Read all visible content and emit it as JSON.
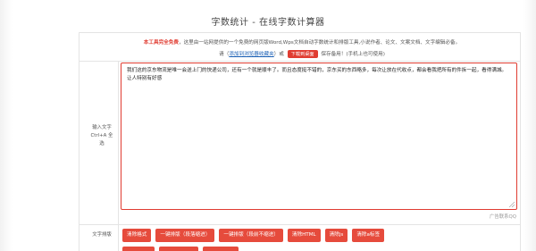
{
  "header": {
    "title": "字数统计 - 在线字数计算器"
  },
  "intro": {
    "free_label": "本工具完全免费",
    "description": "，这里由一站网提供的一个免费的网页版Word,Wps文档自动字数统计和排版工具,小说作者、论文、文案文档、文字编辑必备。",
    "please_prefix": "请（",
    "bookmark_link": "添加到浏览器收藏夹",
    "or_text": "）或",
    "download_button": "下载到桌面",
    "save_suffix": "保存备用！(手机上也可使用)"
  },
  "input_row": {
    "label_line1": "输入文字",
    "label_line2": "Ctrl+A 全",
    "label_line3": "选",
    "text": "我们这的京东物流是唯一会送上门的快递公司，还有一个就是顺丰了。而且态度挺不错的，京东买的东西略多，每次让放在代收点，都会看我把所有的件拆一起，看得满城。让人特别有好感"
  },
  "ad": {
    "label": "广告联系QQ"
  },
  "format_row": {
    "label": "文字排版",
    "buttons": [
      {
        "label": "清除格式"
      },
      {
        "label": "一键排版（段落缩进）"
      },
      {
        "label": "一键排版（段前不缩进）"
      },
      {
        "label": "清除HTML"
      },
      {
        "label": "清除js"
      },
      {
        "label": "清除a标签"
      }
    ]
  },
  "colors": {
    "accent": "#e64b3c",
    "link": "#1a5fb4",
    "border": "#e03c31"
  }
}
